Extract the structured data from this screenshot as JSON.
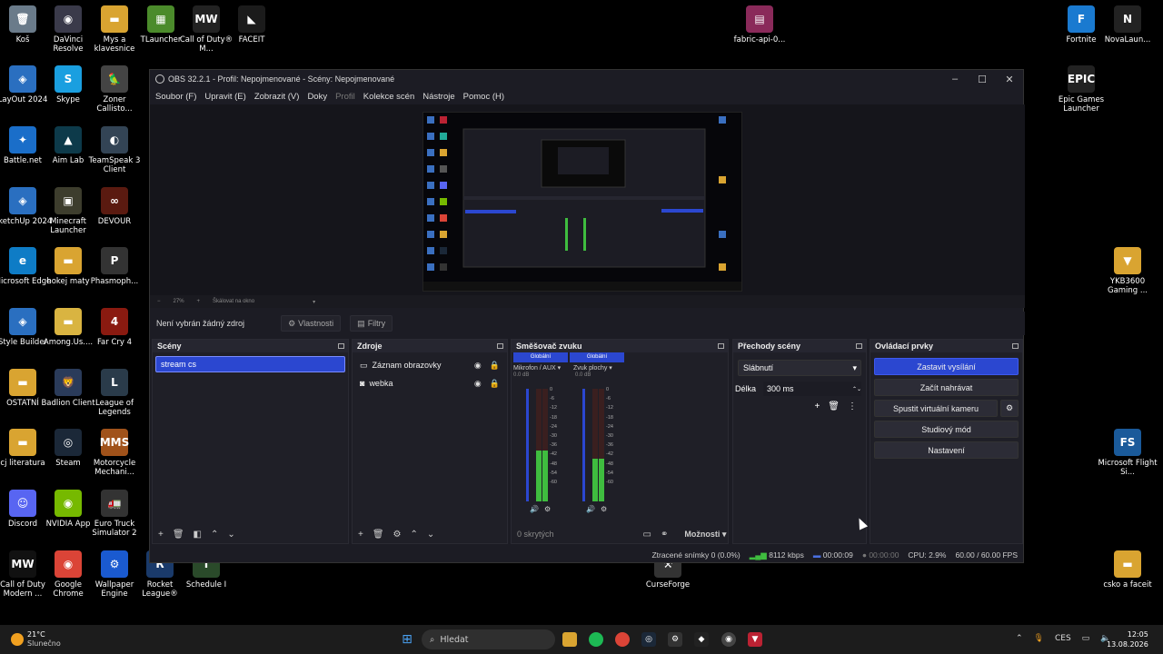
{
  "desktop": {
    "icons": [
      {
        "label": "Koš",
        "color": "#6a7b8a",
        "glyph": "🗑"
      },
      {
        "label": "DaVinci Resolve",
        "color": "#3a3a4a",
        "glyph": "◉"
      },
      {
        "label": "Mys a klavesnice",
        "color": "#d9a431",
        "glyph": "▬"
      },
      {
        "label": "TLauncher",
        "color": "#4b8b2b",
        "glyph": "▦"
      },
      {
        "label": "Call of Duty® M...",
        "color": "#222",
        "glyph": "MW"
      },
      {
        "label": "FACEIT",
        "color": "#1b1b1b",
        "glyph": "◣"
      },
      {
        "label": "LayOut 2024",
        "color": "#2a6fc0",
        "glyph": "◈"
      },
      {
        "label": "Skype",
        "color": "#1a9fe0",
        "glyph": "S"
      },
      {
        "label": "Zoner Callisto...",
        "color": "#444",
        "glyph": "🦜"
      },
      {
        "label": "Battle.net",
        "color": "#1a6ec9",
        "glyph": "✦"
      },
      {
        "label": "Aim Lab",
        "color": "#0d3a4a",
        "glyph": "▲"
      },
      {
        "label": "TeamSpeak 3 Client",
        "color": "#345",
        "glyph": "◐"
      },
      {
        "label": "SketchUp 2024",
        "color": "#2a6fc0",
        "glyph": "◈"
      },
      {
        "label": "Minecraft Launcher",
        "color": "#3d3d2d",
        "glyph": "▣"
      },
      {
        "label": "DEVOUR",
        "color": "#5a1a10",
        "glyph": "∞"
      },
      {
        "label": "Microsoft Edge",
        "color": "#0e7cc6",
        "glyph": "e"
      },
      {
        "label": "hokej maty",
        "color": "#d9a431",
        "glyph": "▬"
      },
      {
        "label": "Phasmoph...",
        "color": "#333",
        "glyph": "P"
      },
      {
        "label": "Style Builder",
        "color": "#2a6fc0",
        "glyph": "◈"
      },
      {
        "label": "Among.Us....",
        "color": "#d9b441",
        "glyph": "▬"
      },
      {
        "label": "Far Cry 4",
        "color": "#8a1a10",
        "glyph": "4"
      },
      {
        "label": "OSTATNÍ",
        "color": "#d9a431",
        "glyph": "▬"
      },
      {
        "label": "Badlion Client",
        "color": "#2a3b5a",
        "glyph": "🦁"
      },
      {
        "label": "League of Legends",
        "color": "#2a3b4a",
        "glyph": "L"
      },
      {
        "label": "cj literatura",
        "color": "#d9a431",
        "glyph": "▬"
      },
      {
        "label": "Steam",
        "color": "#1b2838",
        "glyph": "◎"
      },
      {
        "label": "Motorcycle Mechani...",
        "color": "#a0521a",
        "glyph": "MMS"
      },
      {
        "label": "Discord",
        "color": "#5865f2",
        "glyph": "☺"
      },
      {
        "label": "NVIDIA App",
        "color": "#76b900",
        "glyph": "◉"
      },
      {
        "label": "Euro Truck Simulator 2",
        "color": "#333",
        "glyph": "🚛"
      },
      {
        "label": "Call of Duty Modern ...",
        "color": "#111",
        "glyph": "MW"
      },
      {
        "label": "Google Chrome",
        "color": "#db4437",
        "glyph": "◉"
      },
      {
        "label": "Wallpaper Engine",
        "color": "#1a5ad0",
        "glyph": "⚙"
      },
      {
        "label": "Rocket League®",
        "color": "#1a3a6a",
        "glyph": "R"
      },
      {
        "label": "Schedule I",
        "color": "#2a4a2a",
        "glyph": "I"
      },
      {
        "label": "fabric-api-0...",
        "color": "#8a2a5a",
        "glyph": "▤"
      },
      {
        "label": "CurseForge",
        "color": "#333",
        "glyph": "⚒"
      },
      {
        "label": "Fortnite",
        "color": "#1a7ad0",
        "glyph": "F"
      },
      {
        "label": "NovaLaun...",
        "color": "#222",
        "glyph": "N"
      },
      {
        "label": "Epic Games Launcher",
        "color": "#222",
        "glyph": "EPIC"
      },
      {
        "label": "YKB3600 Gaming ...",
        "color": "#d9a431",
        "glyph": "▼"
      },
      {
        "label": "Microsoft Flight Si...",
        "color": "#1a5a9a",
        "glyph": "FS"
      },
      {
        "label": "csko a faceit",
        "color": "#d9a431",
        "glyph": "▬"
      }
    ]
  },
  "obs": {
    "title": "OBS 32.2.1 - Profil: Nepojmenované - Scény: Nepojmenované",
    "menu": [
      "Soubor (F)",
      "Upravit (E)",
      "Zobrazit (V)",
      "Doky",
      "Profil",
      "Kolekce scén",
      "Nástroje",
      "Pomoc (H)"
    ],
    "zoom": {
      "level": "27%",
      "mode": "Škálovat na okno"
    },
    "context": {
      "no_source": "Není vybrán žádný zdroj",
      "properties": "Vlastnosti",
      "filters": "Filtry"
    },
    "scenes": {
      "title": "Scény",
      "items": [
        "stream cs"
      ]
    },
    "sources": {
      "title": "Zdroje",
      "items": [
        {
          "name": "Záznam obrazovky",
          "icon": "monitor-icon"
        },
        {
          "name": "webka",
          "icon": "camera-icon"
        }
      ]
    },
    "mixer": {
      "title": "Směšovač zvuku",
      "channels": [
        {
          "header": "Globální",
          "name": "Mikrofon / AUX",
          "db": "0.0 dB",
          "level": 0.45
        },
        {
          "header": "Globální",
          "name": "Zvuk plochy",
          "db": "0.0 dB",
          "level": 0.38
        }
      ],
      "scale": [
        "0",
        "-6",
        "-12",
        "-18",
        "-24",
        "-30",
        "-36",
        "-42",
        "-48",
        "-54",
        "-60"
      ],
      "hidden": "0 skrytých",
      "options": "Možnosti"
    },
    "transitions": {
      "title": "Přechody scény",
      "selected": "Slábnutí",
      "duration_label": "Délka",
      "duration": "300 ms"
    },
    "controls": {
      "title": "Ovládací prvky",
      "stop_stream": "Zastavit vysílání",
      "start_record": "Začít nahrávat",
      "virtual_cam": "Spustit virtuální kameru",
      "studio": "Studiový mód",
      "settings": "Nastavení"
    },
    "status": {
      "dropped": "Ztracené snímky 0 (0.0%)",
      "bitrate": "8112 kbps",
      "stream_time": "00:00:09",
      "rec_time": "00:00:00",
      "cpu": "CPU: 2.9%",
      "fps": "60.00 / 60.00 FPS"
    }
  },
  "taskbar": {
    "weather_temp": "21°C",
    "weather_desc": "Slunečno",
    "search": "Hledat",
    "lang": "CES",
    "time": "12:05",
    "date": "13.08.2026"
  }
}
